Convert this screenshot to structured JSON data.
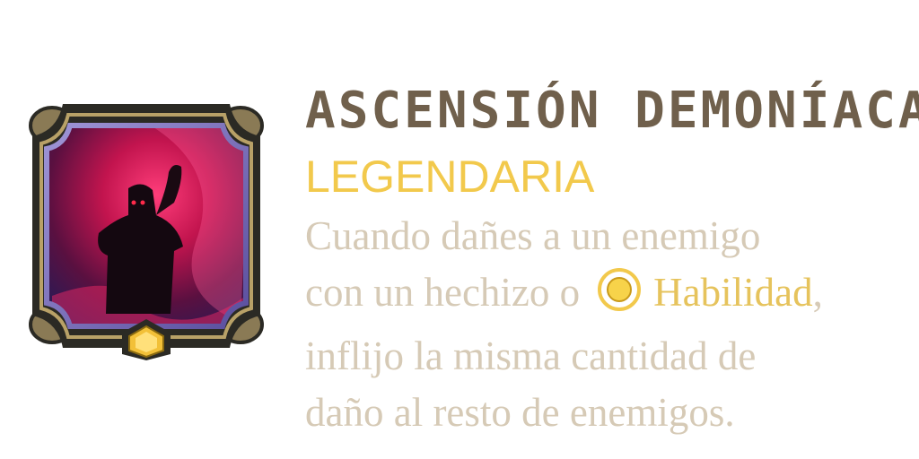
{
  "card": {
    "title": "ASCENSIÓN DEMONÍACA",
    "rarity": "LEGENDARIA",
    "description": {
      "line1": "Cuando dañes a un enemigo",
      "line2_pre": "con un hechizo o",
      "ability_icon": "ability-ring-icon",
      "ability_label": "Habilidad",
      "line2_post": ",",
      "line3": "inflijo la misma cantidad de",
      "line4": "daño al resto de enemigos."
    },
    "emblem_icon": "demon-ascension-emblem",
    "rarity_gem_icon": "hexagon-gem-icon"
  },
  "colors": {
    "title": "#70604c",
    "rarity": "#f2c94c",
    "description": "#d6cab6",
    "ability_highlight": "#e6c35c",
    "frame_dark": "#2b2a24",
    "frame_gold": "#b8a167",
    "art_magenta": "#c2144e",
    "art_purple": "#4b3a8c"
  }
}
